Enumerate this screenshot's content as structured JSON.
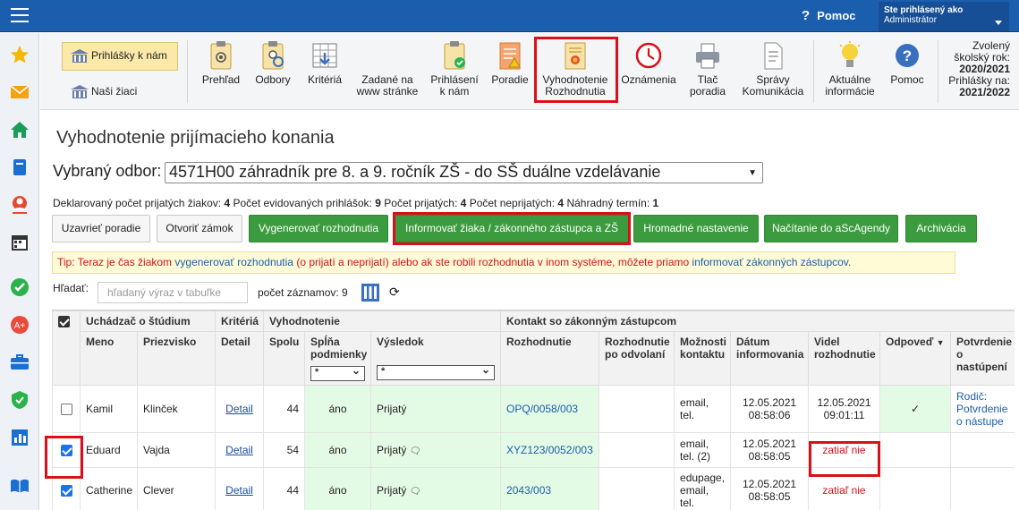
{
  "topbar": {
    "help_label": "Pomoc",
    "user_label": "Ste prihlásený ako",
    "user_name": "Administrátor"
  },
  "sidebar": {
    "icons": [
      "star-icon",
      "mail-icon",
      "home-icon",
      "book-icon",
      "person-icon",
      "calendar-icon",
      "check-icon",
      "badge-icon",
      "briefcase-icon",
      "shield-icon",
      "chart-icon",
      "reader-icon"
    ]
  },
  "toolbar": {
    "left": [
      {
        "label": "Prihlášky k nám",
        "active": true
      },
      {
        "label": "Naši žiaci",
        "active": false
      }
    ],
    "buttons": [
      {
        "label": "Prehľad"
      },
      {
        "label": "Odbory"
      },
      {
        "label": "Kritériá"
      },
      {
        "label": "Zadané na www stránke"
      },
      {
        "label": "Prihlásení k nám"
      },
      {
        "label": "Poradie"
      },
      {
        "label": "Vyhodnotenie Rozhodnutia"
      },
      {
        "label": "Oznámenia"
      },
      {
        "label": "Tlač poradia"
      },
      {
        "label": "Správy Komunikácia"
      },
      {
        "label": "Aktuálne informácie"
      },
      {
        "label": "Pomoc"
      }
    ],
    "year_label": "Zvolený školský rok:",
    "year_value": "2020/2021",
    "apps_label": "Prihlášky na:",
    "apps_value": "2021/2022"
  },
  "page": {
    "title": "Vyhodnotenie prijímacieho konania",
    "odbor_label": "Vybraný odbor:",
    "odbor_value": "4571H00 záhradník pre 8. a 9. ročník ZŠ - do SŠ duálne vzdelávanie"
  },
  "stats": {
    "declared_label": "Deklarovaný počet prijatých žiakov:",
    "declared": "4",
    "registered_label": "Počet evidovaných prihlášok:",
    "registered": "9",
    "accepted_label": "Počet prijatých:",
    "accepted": "4",
    "rejected_label": "Počet neprijatých:",
    "rejected": "4",
    "alt_label": "Náhradný termín:",
    "alt": "1"
  },
  "actions": {
    "close_order": "Uzavrieť poradie",
    "open_lock": "Otvoriť zámok",
    "generate": "Vygenerovať rozhodnutia",
    "inform": "Informovať žiaka / zákonného zástupca a ZŠ",
    "bulk": "Hromadné nastavenie",
    "load": "Načítanie do aScAgendy",
    "archive": "Archivácia"
  },
  "tip": {
    "prefix": "Tip: Teraz je čas žiakom ",
    "link1": "vygenerovať rozhodnutia",
    "middle": " (o prijatí a neprijatí) alebo ak ste robili rozhodnutia v inom systéme, môžete priamo ",
    "link2": "informovať zákonných zástupcov",
    "suffix": "."
  },
  "search": {
    "label": "Hľadať:",
    "placeholder": "hľadaný výraz v tabuľke",
    "count_label": "počet záznamov: 9"
  },
  "table": {
    "group_applicant": "Uchádzač o štúdium",
    "group_criteria": "Kritériá",
    "group_eval": "Vyhodnotenie",
    "group_contact": "Kontakt so zákonným zástupcom",
    "col_first": "Meno",
    "col_last": "Priezvisko",
    "col_detail": "Detail",
    "col_total": "Spolu",
    "col_meets": "Spĺňa podmienky",
    "col_result": "Výsledok",
    "col_decision": "Rozhodnutie",
    "col_appeal": "Rozhodnutie po odvolaní",
    "col_contact": "Možnosti kontaktu",
    "col_date": "Dátum informovania",
    "col_seen": "Videl rozhodnutie",
    "col_reply": "Odpoveď",
    "col_confirm": "Potvrdenie o nastúpení",
    "filter_all": "*",
    "rows": [
      {
        "checked": false,
        "first": "Kamil",
        "last": "Klinček",
        "detail": "Detail",
        "total": "44",
        "meets": "áno",
        "result": "Prijatý",
        "decision": "OPQ/0058/003",
        "appeal": "",
        "contact": "email, tel.",
        "date": "12.05.2021",
        "time": "08:58:06",
        "seen_date": "12.05.2021",
        "seen_time": "09:01:11",
        "reply": "✓",
        "confirm": "Rodič: Potvrdenie o nástupe"
      },
      {
        "checked": true,
        "first": "Eduard",
        "last": "Vajda",
        "detail": "Detail",
        "total": "54",
        "meets": "áno",
        "result": "Prijatý",
        "decision": "XYZ123/0052/003",
        "appeal": "",
        "contact": "email, tel. (2)",
        "date": "12.05.2021",
        "time": "08:58:05",
        "seen": "zatiaľ nie",
        "reply": "",
        "confirm": ""
      },
      {
        "checked": true,
        "first": "Catherine",
        "last": "Clever",
        "detail": "Detail",
        "total": "44",
        "meets": "áno",
        "result": "Prijatý",
        "decision": "2043/003",
        "appeal": "",
        "contact": "edupage, email, tel.",
        "date": "12.05.2021",
        "time": "08:58:05",
        "seen": "zatiaľ nie",
        "reply": "",
        "confirm": ""
      }
    ]
  }
}
